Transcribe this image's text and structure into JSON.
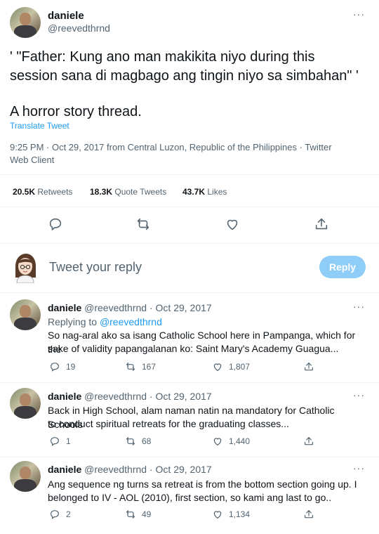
{
  "tweet": {
    "author_name": "daniele",
    "author_handle": "@reevedthrnd",
    "more_label": "···",
    "text_line1": "' \"Father: Kung ano man makikita niyo during this",
    "text_line2": "session sana di magbago ang tingin niyo sa simbahan\" '",
    "text_line3": "A horror story thread.",
    "translate_label": "Translate Tweet",
    "meta_line1": "9:25 PM · Oct 29, 2017 from Central Luzon, Republic of the Philippines · Twitter",
    "meta_line2": "Web Client",
    "stats": {
      "retweets_count": "20.5K",
      "retweets_label": "Retweets",
      "quotes_count": "18.3K",
      "quotes_label": "Quote Tweets",
      "likes_count": "43.7K",
      "likes_label": "Likes"
    }
  },
  "compose": {
    "placeholder": "Tweet your reply",
    "reply_button": "Reply"
  },
  "replies": [
    {
      "name": "daniele",
      "handle": "@reevedthrnd",
      "date": "· Oct 29, 2017",
      "replying_prefix": "Replying to",
      "replying_handle": "@reevedthrnd",
      "line1": "So nag-aral ako sa isang Catholic School here in Pampanga, which for the",
      "line2": "sake of validity papangalanan ko: Saint Mary's Academy Guagua...",
      "replies": "19",
      "retweets": "167",
      "likes": "1,807"
    },
    {
      "name": "daniele",
      "handle": "@reevedthrnd",
      "date": "· Oct 29, 2017",
      "line1": "Back in High School, alam naman natin na mandatory for Catholic Schools",
      "line2": "to conduct spiritual retreats for the graduating classes...",
      "replies": "1",
      "retweets": "68",
      "likes": "1,440"
    },
    {
      "name": "daniele",
      "handle": "@reevedthrnd",
      "date": "· Oct 29, 2017",
      "line1": "Ang sequence ng turns sa retreat is from the bottom section going up. I",
      "line2": "belonged to IV - AOL (2010), first section, so kami ang last to go..",
      "replies": "2",
      "retweets": "49",
      "likes": "1,134"
    }
  ],
  "colors": {
    "accent": "#1d9bf0",
    "reply_button_disabled": "#8ecdf8",
    "muted": "#536471",
    "divider": "#eff3f4"
  }
}
